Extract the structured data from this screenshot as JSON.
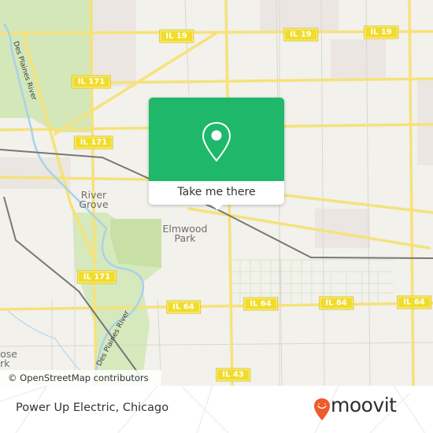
{
  "map": {
    "places": [
      {
        "name": "River Grove",
        "lines": [
          "River",
          "Grove"
        ]
      },
      {
        "name": "Elmwood Park",
        "lines": [
          "Elmwood",
          "Park"
        ]
      },
      {
        "name": "Melrose Park (partial)",
        "lines": [
          "ose",
          "rk"
        ]
      }
    ],
    "rivers": [
      "Des Plaines River",
      "Des Plaines River"
    ],
    "shields": [
      {
        "id": "il19-a",
        "label": "IL 19"
      },
      {
        "id": "il19-b",
        "label": "IL 19"
      },
      {
        "id": "il19-c",
        "label": "IL 19"
      },
      {
        "id": "il171-a",
        "label": "IL 171"
      },
      {
        "id": "il171-b",
        "label": "IL 171"
      },
      {
        "id": "il171-c",
        "label": "IL 171"
      },
      {
        "id": "il64-a",
        "label": "IL 64"
      },
      {
        "id": "il64-b",
        "label": "IL 64"
      },
      {
        "id": "il64-c",
        "label": "IL 64"
      },
      {
        "id": "il64-d",
        "label": "IL 64"
      },
      {
        "id": "il43",
        "label": "IL 43"
      }
    ],
    "attribution": "© OpenStreetMap contributors"
  },
  "popup": {
    "icon": "location-pin-icon",
    "button_label": "Take me there",
    "color": "#1fb86a"
  },
  "footer": {
    "title": "Power Up Electric, Chicago",
    "brand": "moovit",
    "brand_color": "#f05a28"
  }
}
